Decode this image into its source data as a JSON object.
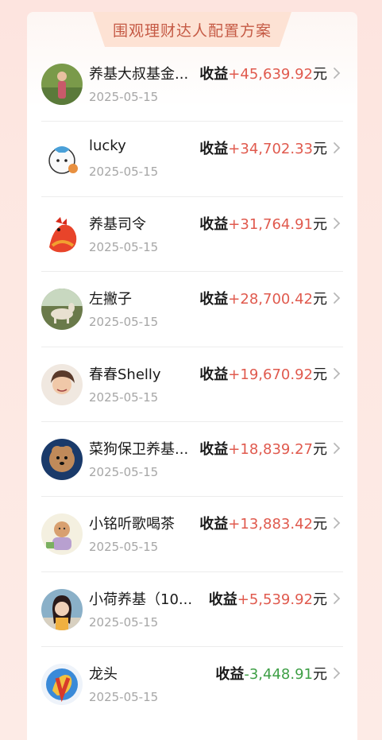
{
  "header": {
    "title": "围观理财达人配置方案"
  },
  "earning_label": "收益",
  "currency_suffix": "元",
  "rows": [
    {
      "name": "养基大叔基金...",
      "date": "2025-05-15",
      "value": "+45,639.92",
      "sign": "pos",
      "avatar": "man-forest-avatar",
      "colors": [
        "#7a9a4a",
        "#c85a6a"
      ]
    },
    {
      "name": "lucky",
      "date": "2025-05-15",
      "value": "+34,702.33",
      "sign": "pos",
      "avatar": "cartoon-cat-avatar",
      "colors": [
        "#ffffff",
        "#4aa0d8"
      ]
    },
    {
      "name": "养基司令",
      "date": "2025-05-15",
      "value": "+31,764.91",
      "sign": "pos",
      "avatar": "rooster-avatar",
      "colors": [
        "#e8442a",
        "#f2a030"
      ]
    },
    {
      "name": "左撇子",
      "date": "2025-05-15",
      "value": "+28,700.42",
      "sign": "pos",
      "avatar": "horse-avatar",
      "colors": [
        "#6a7a4a",
        "#e8e0d0"
      ]
    },
    {
      "name": "春春Shelly",
      "date": "2025-05-15",
      "value": "+19,670.92",
      "sign": "pos",
      "avatar": "woman-smiling-avatar",
      "colors": [
        "#f0e8e0",
        "#5a3a2a"
      ]
    },
    {
      "name": "菜狗保卫养基...",
      "date": "2025-05-15",
      "value": "+18,839.27",
      "sign": "pos",
      "avatar": "poodle-avatar",
      "colors": [
        "#1a3a6a",
        "#c08a5a"
      ]
    },
    {
      "name": "小铭听歌喝茶",
      "date": "2025-05-15",
      "value": "+13,883.42",
      "sign": "pos",
      "avatar": "monk-cartoon-avatar",
      "colors": [
        "#f4f0e0",
        "#d8a070"
      ]
    },
    {
      "name": "小荷养基（10...",
      "date": "2025-05-15",
      "value": "+5,539.92",
      "sign": "pos",
      "avatar": "woman-portrait-avatar",
      "colors": [
        "#8ab0c8",
        "#2a1a1a"
      ]
    },
    {
      "name": "龙头",
      "date": "2025-05-15",
      "value": "-3,448.91",
      "sign": "neg",
      "avatar": "dragon-emblem-avatar",
      "colors": [
        "#3a8ad8",
        "#d83a2a"
      ]
    }
  ]
}
